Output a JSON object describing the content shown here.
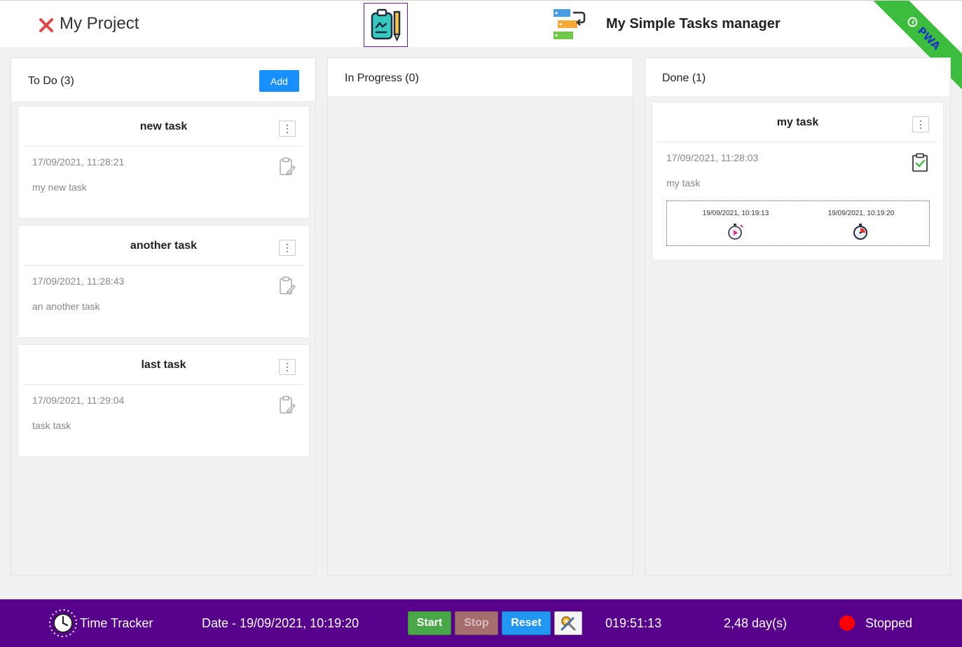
{
  "header": {
    "project_title": "My Project",
    "app_title": "My Simple Tasks manager",
    "ribbon_label": "PWA"
  },
  "columns": {
    "todo": {
      "title": "To Do (3)",
      "add_label": "Add"
    },
    "in_progress": {
      "title": "In Progress (0)"
    },
    "done": {
      "title": "Done (1)"
    }
  },
  "todo_cards": [
    {
      "title": "new task",
      "date": "17/09/2021, 11:28:21",
      "description": "my new task"
    },
    {
      "title": "another task",
      "date": "17/09/2021, 11:28:43",
      "description": "an another task"
    },
    {
      "title": "last task",
      "date": "17/09/2021, 11:29:04",
      "description": "task task"
    }
  ],
  "done_cards": [
    {
      "title": "my task",
      "date": "17/09/2021, 11:28:03",
      "description": "my task",
      "start_time": "19/09/2021, 10:19:13",
      "stop_time": "19/09/2021, 10:19:20"
    }
  ],
  "menu_glyph": "⋮",
  "footer": {
    "tracker_label": "Time Tracker",
    "date_label": "Date - 19/09/2021, 10:19:20",
    "start_label": "Start",
    "stop_label": "Stop",
    "reset_label": "Reset",
    "elapsed": "019:51:13",
    "days": "2,48 day(s)",
    "status": "Stopped"
  },
  "colors": {
    "accent_blue": "#1890ff",
    "footer_purple": "#56008c",
    "ribbon_green": "#3dbd3d",
    "status_red": "#ff0000",
    "close_red": "#e0464b"
  },
  "icons": [
    "close-icon",
    "notepad-pencil-logo-icon",
    "stacked-tasks-logo-icon",
    "clock-icon",
    "clipboard-edit-icon",
    "clipboard-check-icon",
    "stopwatch-play-icon",
    "stopwatch-stop-icon",
    "tools-icon"
  ]
}
